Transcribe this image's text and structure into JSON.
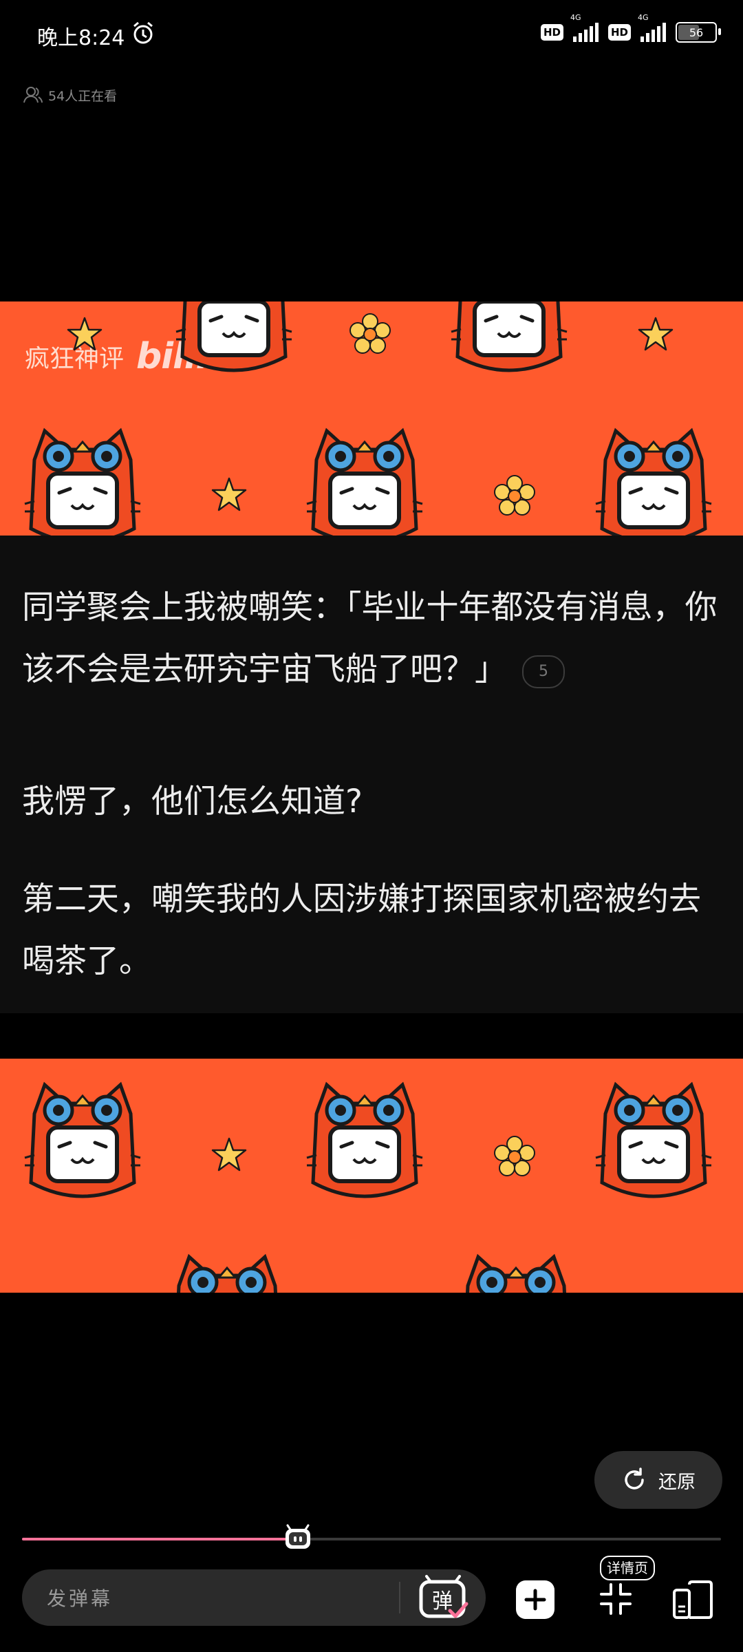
{
  "status_bar": {
    "time": "晚上8:24",
    "hd1": "HD",
    "net1": "4G",
    "hd2": "HD",
    "net2": "4G",
    "battery": "56"
  },
  "viewers": {
    "text": "54人正在看"
  },
  "video": {
    "watermark_text": "疯狂神评",
    "watermark_logo": "bilibili",
    "paragraph1": "同学聚会上我被嘲笑：「毕业十年都没有消息，你该不会是去研究宇宙飞船了吧？」",
    "note_count": "5",
    "paragraph2": "我愣了，他们怎么知道?",
    "paragraph3": "第二天，嘲笑我的人因涉嫌打探国家机密被约去喝茶了。"
  },
  "controls": {
    "restore_label": "还原",
    "progress_fraction": 0.395,
    "danmaku_placeholder": "发弹幕",
    "danmaku_toggle_label": "弹",
    "details_label": "详情页"
  },
  "colors": {
    "banner": "#ff5a2d",
    "progress": "#fb7299"
  }
}
